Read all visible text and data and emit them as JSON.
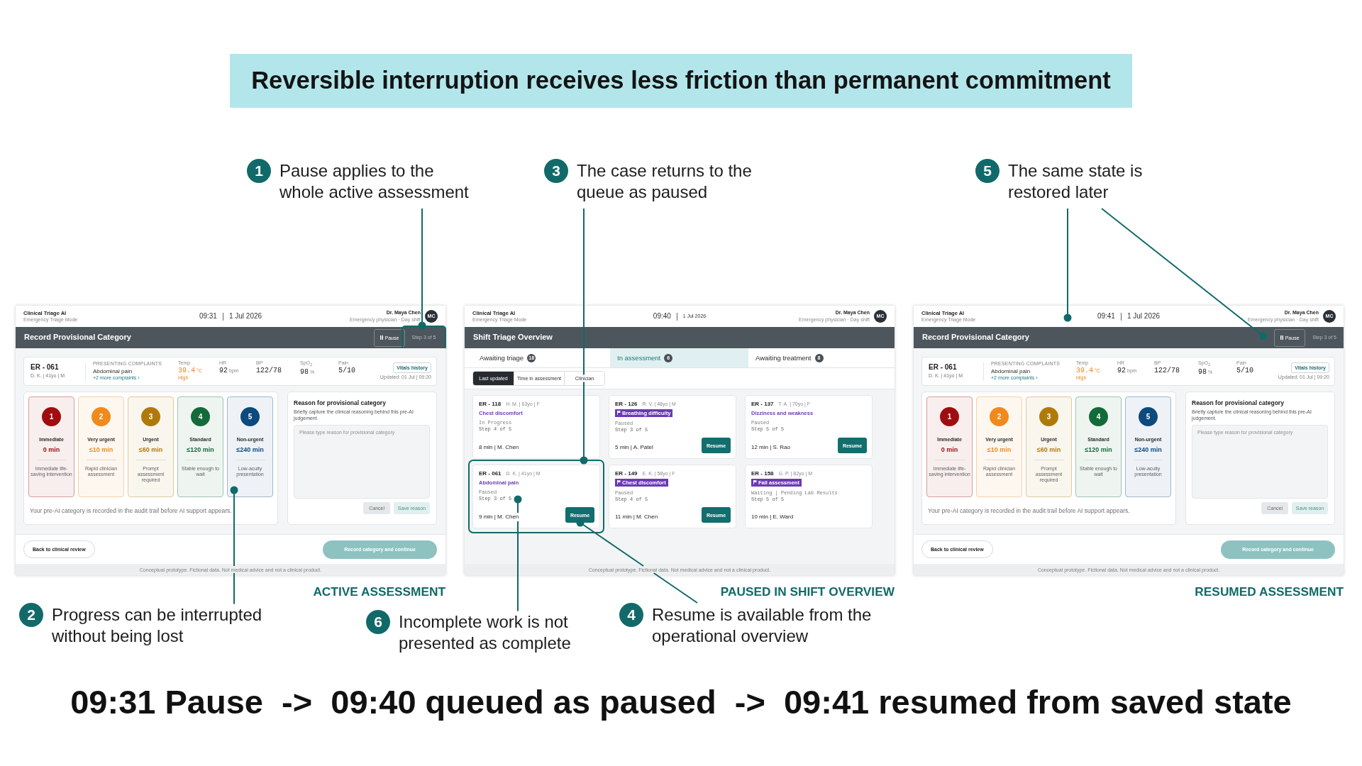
{
  "title": "Reversible interruption receives less friction than permanent commitment",
  "callouts_top": [
    {
      "number": "1",
      "lines": [
        "Pause applies to the",
        "whole active assessment"
      ]
    },
    {
      "number": "3",
      "lines": [
        "The case returns to the",
        "queue as paused"
      ]
    },
    {
      "number": "5",
      "lines": [
        "The same state is",
        "restored later"
      ]
    }
  ],
  "panels": [
    {
      "kind": "record",
      "caption": "ACTIVE ASSESSMENT",
      "header": {
        "app": "Clinical Triage AI",
        "mode": "Emergency Triage Mode",
        "time": "09:31",
        "date": "1 Jul 2026",
        "date_small": false,
        "user": "Dr. Maya Chen",
        "role": "Emergency physician · Day shift",
        "initials": "MC"
      },
      "bar": {
        "title": "Record Provisional Category",
        "pause": "Pause",
        "step": "Step 3 of 5",
        "step_highlighted": true
      },
      "patient": {
        "id": "ER - 061",
        "details": "D. K. | 41yo | M",
        "complaints_label": "PRESENTING COMPLAINTS",
        "complaint": "Abdominal pain",
        "more": "+2 more complaints ›"
      },
      "vitals": [
        {
          "label": "Temp",
          "value": "39.4",
          "unit": "°C",
          "note": "High",
          "alert": true
        },
        {
          "label": "HR",
          "value": "92",
          "unit": "bpm",
          "alert": false
        },
        {
          "label": "BP",
          "value": "122/78",
          "alert": false
        },
        {
          "label": "SpO$_{2}$",
          "value": "98",
          "unit": "%",
          "alert": false
        },
        {
          "label": "Pain",
          "value": "5/10",
          "alert": false
        }
      ],
      "vitals_history": "Vitals history",
      "updated": "Updated: 01 Jul | 09:20",
      "categories": [
        {
          "number": "1",
          "name": "Immediate",
          "time": "0 min",
          "description": "Immediate life-saving intervention",
          "color": "#a00d10"
        },
        {
          "number": "2",
          "name": "Very urgent",
          "time": "≤10 min",
          "description": "Rapid clinician assessment",
          "color": "#f08a1c"
        },
        {
          "number": "3",
          "name": "Urgent",
          "time": "≤60 min",
          "description": "Prompt assessment required",
          "color": "#b07a0a"
        },
        {
          "number": "4",
          "name": "Standard",
          "time": "≤120 min",
          "description": "Stable enough to wait",
          "color": "#136b3a"
        },
        {
          "number": "5",
          "name": "Non-urgent",
          "time": "≤240 min",
          "description": "Low-acuity presentation",
          "color": "#0d4a7d"
        }
      ],
      "audit_note": "Your pre-AI category is recorded in the audit trail before AI support appears.",
      "reason": {
        "title": "Reason for provisional category",
        "hint": "Briefly capture the clinical reasoning behind this pre-AI judgement.",
        "placeholder": "Please type reason for provisional category",
        "cancel": "Cancel",
        "save": {
          "label": "Save reason",
          "disabled": true
        }
      },
      "back": "Back to clinical review",
      "continue": {
        "label": "Record category and continue",
        "disabled": true
      },
      "disclaimer": "Conceptual prototype. Fictional data. Not medical advice and not a clinical product."
    },
    {
      "kind": "overview",
      "caption": "PAUSED IN SHIFT OVERVIEW",
      "header": {
        "app": "Clinical Triage AI",
        "mode": "Emergency Triage Mode",
        "time": "09:40",
        "date": "1 Jul 2026",
        "date_small": true,
        "user": "Dr. Maya Chen",
        "role": "Emergency physician · Day shift",
        "initials": "MC"
      },
      "bar": {
        "title": "Shift Triage Overview"
      },
      "tabs": [
        {
          "label": "Awaiting triage",
          "count": "18",
          "selected": false
        },
        {
          "label": "In assessment",
          "count": "6",
          "selected": true
        },
        {
          "label": "Awaiting treatment",
          "count": "8",
          "selected": false
        }
      ],
      "sort_options": [
        {
          "label": "Last updated",
          "selected": true
        },
        {
          "label": "Time in assessment",
          "selected": false
        },
        {
          "label": "Clinician",
          "selected": false
        }
      ],
      "cases": [
        {
          "id": "ER - 118",
          "details": "H. M. | 63yo | F",
          "complaint": "Chest discomfort",
          "flagged": false,
          "status": "In Progress",
          "step": "Step 4 of 5",
          "summary": "8 min | M. Chen",
          "highlighted": false
        },
        {
          "id": "ER - 126",
          "details": "R. V. | 48yo | M",
          "complaint": "Breathing difficulty",
          "flagged": true,
          "status": "Paused",
          "step": "Step 3 of 5",
          "summary": "5 min | A. Patel",
          "action": "Resume",
          "highlighted": false
        },
        {
          "id": "ER - 137",
          "details": "T. A. | 70yo | F",
          "complaint": "Dizziness and weakness",
          "flagged": false,
          "status": "Paused",
          "step": "Step 5 of 5",
          "summary": "12 min | S. Rao",
          "action": "Resume",
          "highlighted": false
        },
        {
          "id": "ER - 061",
          "details": "D. K. | 41yo | M",
          "complaint": "Abdominal pain",
          "flagged": false,
          "status": "Paused",
          "step": "Step 3 of 5",
          "summary": "9 min | M. Chen",
          "action": "Resume",
          "highlighted": true
        },
        {
          "id": "ER - 149",
          "details": "E. K. | 58yo | F",
          "complaint": "Chest discomfort",
          "flagged": true,
          "status": "Paused",
          "step": "Step 4 of 5",
          "summary": "11 min | M. Chen",
          "action": "Resume",
          "highlighted": false
        },
        {
          "id": "ER - 158",
          "details": "G. P. | 82yo | M",
          "complaint": "Fall assessment",
          "flagged": true,
          "status": "Waiting | Pending Lab Results",
          "step": "Step 5 of 5",
          "summary": "10 min | E. Ward",
          "highlighted": false
        }
      ],
      "disclaimer": "Conceptual prototype. Fictional data. Not medical advice and not a clinical product."
    },
    {
      "kind": "record",
      "caption": "RESUMED ASSESSMENT",
      "header": {
        "app": "Clinical Triage AI",
        "mode": "Emergency Triage Mode",
        "time": "09:41",
        "date": "1 Jul 2026",
        "date_small": false,
        "user": "Dr. Maya Chen",
        "role": "Emergency physician · Day shift",
        "initials": "MC"
      },
      "bar": {
        "title": "Record Provisional Category",
        "pause": "Pause",
        "step": "Step 3 of 5",
        "step_highlighted": false
      },
      "patient": {
        "id": "ER - 061",
        "details": "D. K. | 41yo | M",
        "complaints_label": "PRESENTING COMPLAINTS",
        "complaint": "Abdominal pain",
        "more": "+2 more complaints ›"
      },
      "vitals": [
        {
          "label": "Temp",
          "value": "39.4",
          "unit": "°C",
          "note": "High",
          "alert": true
        },
        {
          "label": "HR",
          "value": "92",
          "unit": "bpm",
          "alert": false
        },
        {
          "label": "BP",
          "value": "122/78",
          "alert": false
        },
        {
          "label": "SpO$_{2}$",
          "value": "98",
          "unit": "%",
          "alert": false
        },
        {
          "label": "Pain",
          "value": "5/10",
          "alert": false
        }
      ],
      "vitals_history": "Vitals history",
      "updated": "Updated: 01 Jul | 09:20",
      "categories": [
        {
          "number": "1",
          "name": "Immediate",
          "time": "0 min",
          "description": "Immediate life-saving intervention",
          "color": "#a00d10"
        },
        {
          "number": "2",
          "name": "Very urgent",
          "time": "≤10 min",
          "description": "Rapid clinician assessment",
          "color": "#f08a1c"
        },
        {
          "number": "3",
          "name": "Urgent",
          "time": "≤60 min",
          "description": "Prompt assessment required",
          "color": "#b07a0a"
        },
        {
          "number": "4",
          "name": "Standard",
          "time": "≤120 min",
          "description": "Stable enough to wait",
          "color": "#136b3a"
        },
        {
          "number": "5",
          "name": "Non-urgent",
          "time": "≤240 min",
          "description": "Low-acuity presentation",
          "color": "#0d4a7d"
        }
      ],
      "audit_note": "Your pre-AI category is recorded in the audit trail before AI support appears.",
      "reason": {
        "title": "Reason for provisional category",
        "hint": "Briefly capture the clinical reasoning behind this pre-AI judgement.",
        "placeholder": "Please type reason for provisional category",
        "cancel": "Cancel",
        "save": {
          "label": "Save reason",
          "disabled": true
        }
      },
      "back": "Back to clinical review",
      "continue": {
        "label": "Record category and continue",
        "disabled": true
      },
      "disclaimer": "Conceptual prototype. Fictional data. Not medical advice and not a clinical product."
    }
  ],
  "callouts_bottom": [
    {
      "number": "2",
      "lines": [
        "Progress can be interrupted",
        "without being lost"
      ]
    },
    {
      "number": "6",
      "lines": [
        "Incomplete work is not",
        "presented as complete"
      ]
    },
    {
      "number": "4",
      "lines": [
        "Resume is available from the",
        "operational overview"
      ]
    }
  ],
  "timeline": "09:31 Pause  ->  09:40 queued as paused  ->  09:41 resumed from saved state"
}
